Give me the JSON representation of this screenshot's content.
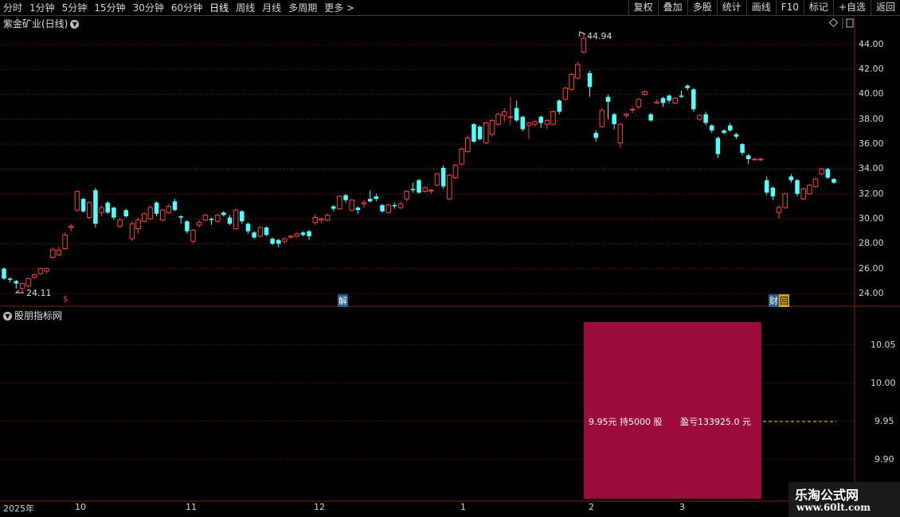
{
  "toolbar": {
    "periods": [
      "分时",
      "1分钟",
      "5分钟",
      "15分钟",
      "30分钟",
      "60分钟",
      "日线",
      "周线",
      "月线",
      "多周期",
      "更多 >"
    ],
    "active": "日线",
    "actions": [
      "复权",
      "叠加",
      "多股",
      "统计",
      "画线",
      "F10",
      "标记",
      "+自选",
      "返回"
    ]
  },
  "chart": {
    "title": "紫金矿业(日线)",
    "y_labels": [
      "44.00",
      "42.00",
      "40.00",
      "38.00",
      "36.00",
      "34.00",
      "32.00",
      "30.00",
      "28.00",
      "26.00",
      "24.00"
    ],
    "max_label": "44.94",
    "min_label": "24.11",
    "event_markers": [
      "$",
      "解",
      "财",
      "回"
    ]
  },
  "indicator": {
    "title": "股朋指标网",
    "y_labels": [
      "10.05",
      "10.00",
      "9.95",
      "9.90"
    ],
    "position_text": "9.95元 持5000 股",
    "pnl_text": "盈亏133925.0 元"
  },
  "x_axis": {
    "labels": [
      "2025年",
      "10",
      "11",
      "12",
      "1",
      "2",
      "3"
    ]
  },
  "watermark": {
    "line1": "乐淘公式网",
    "line2": "www.60lt.com"
  },
  "colors": {
    "up": "#ff4040",
    "down": "#54ffff",
    "grid": "#8a1d1d",
    "pnl_box": "#9b0c3c"
  },
  "chart_data": {
    "type": "candlestick",
    "title": "紫金矿业(日线)",
    "ylim": [
      23.5,
      45.5
    ],
    "candles": [
      [
        26.0,
        25.2,
        26.1,
        25.1
      ],
      [
        25.2,
        25.1,
        25.3,
        24.9
      ],
      [
        25.0,
        24.8,
        25.1,
        24.4
      ],
      [
        24.4,
        24.8,
        24.9,
        24.1
      ],
      [
        24.6,
        25.2,
        25.3,
        24.5
      ],
      [
        25.3,
        25.5,
        25.6,
        25.2
      ],
      [
        25.6,
        26.0,
        26.1,
        25.5
      ],
      [
        25.8,
        26.0,
        26.1,
        25.6
      ],
      [
        26.9,
        27.5,
        27.7,
        26.8
      ],
      [
        27.1,
        27.5,
        27.8,
        27.0
      ],
      [
        27.6,
        28.7,
        28.9,
        27.5
      ],
      [
        29.3,
        29.4,
        29.6,
        29.0
      ],
      [
        30.7,
        32.2,
        32.3,
        30.6
      ],
      [
        31.6,
        30.6,
        31.7,
        30.5
      ],
      [
        30.1,
        31.3,
        31.4,
        30.0
      ],
      [
        32.3,
        29.6,
        32.5,
        29.3
      ],
      [
        30.5,
        30.9,
        31.1,
        30.2
      ],
      [
        31.3,
        30.5,
        31.4,
        30.4
      ],
      [
        30.9,
        30.1,
        31.0,
        29.9
      ],
      [
        29.4,
        29.9,
        30.1,
        29.3
      ],
      [
        30.7,
        30.2,
        30.8,
        30.1
      ],
      [
        28.4,
        29.6,
        29.8,
        28.2
      ],
      [
        29.2,
        29.9,
        30.1,
        28.8
      ],
      [
        29.8,
        30.4,
        30.5,
        29.7
      ],
      [
        30.0,
        30.9,
        31.1,
        29.9
      ],
      [
        31.3,
        30.4,
        31.4,
        30.2
      ],
      [
        29.9,
        30.7,
        30.8,
        29.8
      ],
      [
        30.5,
        31.0,
        31.2,
        30.4
      ],
      [
        31.4,
        30.7,
        31.6,
        30.6
      ],
      [
        30.2,
        30.1,
        30.3,
        29.6
      ],
      [
        29.8,
        29.0,
        29.9,
        28.8
      ],
      [
        28.2,
        29.1,
        29.2,
        28.0
      ],
      [
        29.5,
        29.7,
        29.9,
        29.3
      ],
      [
        29.9,
        30.3,
        30.4,
        29.8
      ],
      [
        30.0,
        29.9,
        30.1,
        29.5
      ],
      [
        29.8,
        30.3,
        30.4,
        29.7
      ],
      [
        30.5,
        30.3,
        30.6,
        30.2
      ],
      [
        30.1,
        29.6,
        30.3,
        29.5
      ],
      [
        29.2,
        30.7,
        30.8,
        29.1
      ],
      [
        30.6,
        29.8,
        30.7,
        29.6
      ],
      [
        29.6,
        29.0,
        29.7,
        28.8
      ],
      [
        28.9,
        28.5,
        29.0,
        28.4
      ],
      [
        28.6,
        29.3,
        29.4,
        28.5
      ],
      [
        29.3,
        28.7,
        29.4,
        28.6
      ],
      [
        28.4,
        28.0,
        28.5,
        27.9
      ],
      [
        28.3,
        28.0,
        28.4,
        27.7
      ],
      [
        28.2,
        28.4,
        28.5,
        28.0
      ],
      [
        28.6,
        28.6,
        28.7,
        28.4
      ],
      [
        28.6,
        28.8,
        28.9,
        28.5
      ],
      [
        28.9,
        28.7,
        29.0,
        28.6
      ],
      [
        29.0,
        28.6,
        29.1,
        28.3
      ],
      [
        29.7,
        30.1,
        30.4,
        29.5
      ],
      [
        29.9,
        30.0,
        30.1,
        29.7
      ],
      [
        29.9,
        30.3,
        30.4,
        29.8
      ],
      [
        31.0,
        30.8,
        31.1,
        30.6
      ],
      [
        30.8,
        31.8,
        31.9,
        30.7
      ],
      [
        31.9,
        31.5,
        32.0,
        31.3
      ],
      [
        30.7,
        31.5,
        31.6,
        30.6
      ],
      [
        30.9,
        30.7,
        31.0,
        30.4
      ],
      [
        31.2,
        31.3,
        31.5,
        30.9
      ],
      [
        31.6,
        31.4,
        32.3,
        31.3
      ],
      [
        31.8,
        31.6,
        32.0,
        31.4
      ],
      [
        31.1,
        30.6,
        31.2,
        30.5
      ],
      [
        30.5,
        31.1,
        31.2,
        30.4
      ],
      [
        31.1,
        31.0,
        31.3,
        30.8
      ],
      [
        30.9,
        31.2,
        31.4,
        30.8
      ],
      [
        31.6,
        32.2,
        32.3,
        31.4
      ],
      [
        32.4,
        32.3,
        32.9,
        32.1
      ],
      [
        33.1,
        32.1,
        33.2,
        32.0
      ],
      [
        32.2,
        32.5,
        32.6,
        32.1
      ],
      [
        32.3,
        32.3,
        32.4,
        32.0
      ],
      [
        32.7,
        33.6,
        33.7,
        32.6
      ],
      [
        34.1,
        32.6,
        34.3,
        32.4
      ],
      [
        31.6,
        33.5,
        33.6,
        31.5
      ],
      [
        33.3,
        34.3,
        34.4,
        33.2
      ],
      [
        34.4,
        35.6,
        35.7,
        34.3
      ],
      [
        35.4,
        36.5,
        36.7,
        35.3
      ],
      [
        37.6,
        36.2,
        37.7,
        36.1
      ],
      [
        37.4,
        36.4,
        37.5,
        36.3
      ],
      [
        36.1,
        37.7,
        37.8,
        36.0
      ],
      [
        36.8,
        37.9,
        38.0,
        36.6
      ],
      [
        37.6,
        38.4,
        38.5,
        37.5
      ],
      [
        38.3,
        38.6,
        38.9,
        37.8
      ],
      [
        38.2,
        38.2,
        39.8,
        37.5
      ],
      [
        38.9,
        37.9,
        39.5,
        37.8
      ],
      [
        38.2,
        37.2,
        38.3,
        37.0
      ],
      [
        37.5,
        37.7,
        37.8,
        36.4
      ],
      [
        37.6,
        37.8,
        37.9,
        37.4
      ],
      [
        38.2,
        37.7,
        38.3,
        37.3
      ],
      [
        37.6,
        37.9,
        38.0,
        37.2
      ],
      [
        37.6,
        38.6,
        38.7,
        37.5
      ],
      [
        39.5,
        38.6,
        39.6,
        38.4
      ],
      [
        39.6,
        40.5,
        40.6,
        39.5
      ],
      [
        40.4,
        41.6,
        41.7,
        40.3
      ],
      [
        41.3,
        42.4,
        42.6,
        41.2
      ],
      [
        43.4,
        44.5,
        44.9,
        43.3
      ],
      [
        41.7,
        40.6,
        41.9,
        39.8
      ],
      [
        36.9,
        36.5,
        37.1,
        36.2
      ],
      [
        37.4,
        38.7,
        38.9,
        37.3
      ],
      [
        39.8,
        39.4,
        40.0,
        38.0
      ],
      [
        38.4,
        37.6,
        38.5,
        37.2
      ],
      [
        36.1,
        37.6,
        37.7,
        35.7
      ],
      [
        38.3,
        38.4,
        38.5,
        38.1
      ],
      [
        38.8,
        38.8,
        39.0,
        38.5
      ],
      [
        39.0,
        39.6,
        39.7,
        38.8
      ],
      [
        40.0,
        40.2,
        40.3,
        39.9
      ],
      [
        38.4,
        37.9,
        38.5,
        37.8
      ],
      [
        39.3,
        39.4,
        39.6,
        39.2
      ],
      [
        39.7,
        39.3,
        39.8,
        39.0
      ],
      [
        39.9,
        39.5,
        40.0,
        39.3
      ],
      [
        39.3,
        39.7,
        39.8,
        39.2
      ],
      [
        39.9,
        39.8,
        40.3,
        39.7
      ],
      [
        40.7,
        40.5,
        40.8,
        40.3
      ],
      [
        40.4,
        38.8,
        40.5,
        38.6
      ],
      [
        38.0,
        38.3,
        38.4,
        37.9
      ],
      [
        38.4,
        37.7,
        38.6,
        37.5
      ],
      [
        37.5,
        37.1,
        37.6,
        36.9
      ],
      [
        36.5,
        35.2,
        36.6,
        34.9
      ],
      [
        37.1,
        36.9,
        37.2,
        36.8
      ],
      [
        37.5,
        37.1,
        37.7,
        37.0
      ],
      [
        36.8,
        36.6,
        36.9,
        36.4
      ],
      [
        36.0,
        35.3,
        36.1,
        35.1
      ],
      [
        35.1,
        34.8,
        35.2,
        34.4
      ],
      [
        34.8,
        34.8,
        34.9,
        34.7
      ],
      [
        34.8,
        34.8,
        34.9,
        34.6
      ],
      [
        33.1,
        32.1,
        33.4,
        31.9
      ],
      [
        32.5,
        31.8,
        32.6,
        31.5
      ],
      [
        30.5,
        30.9,
        31.1,
        30.0
      ],
      [
        30.9,
        32.0,
        32.1,
        30.8
      ],
      [
        33.4,
        33.1,
        33.6,
        32.9
      ],
      [
        33.1,
        32.0,
        33.2,
        31.8
      ],
      [
        31.6,
        32.4,
        32.5,
        31.5
      ],
      [
        32.0,
        32.7,
        32.8,
        31.9
      ],
      [
        32.6,
        33.2,
        33.3,
        32.5
      ],
      [
        33.6,
        34.0,
        34.1,
        33.5
      ],
      [
        34.0,
        33.3,
        34.1,
        33.2
      ],
      [
        33.2,
        32.9,
        33.3,
        32.8
      ]
    ]
  }
}
